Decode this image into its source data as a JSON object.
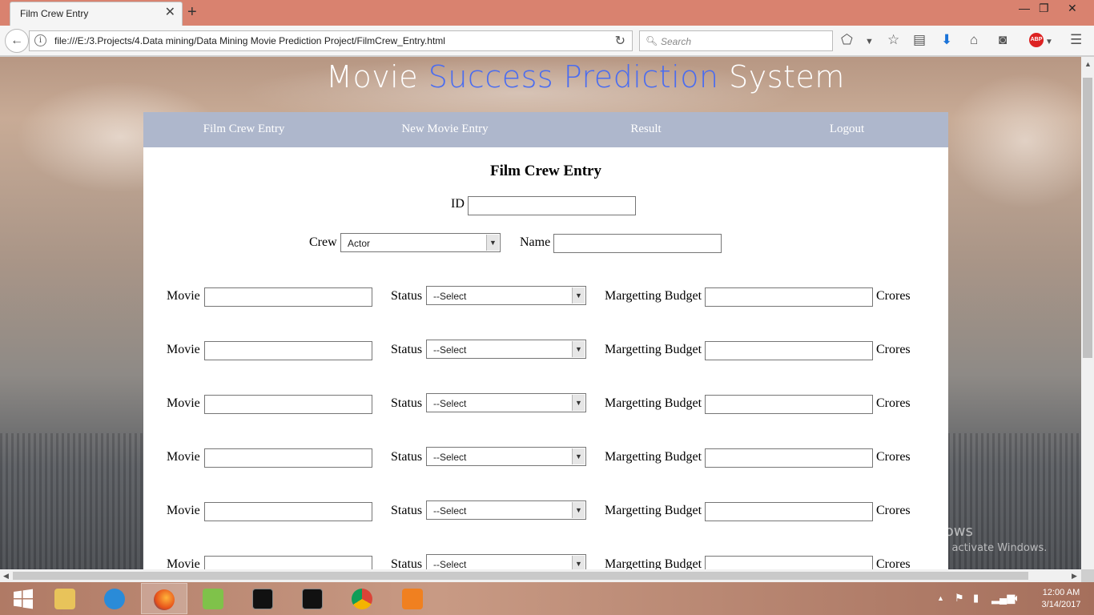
{
  "browser": {
    "tab_title": "Film Crew Entry",
    "url": "file:///E:/3.Projects/4.Data mining/Data Mining Movie Prediction Project/FilmCrew_Entry.html",
    "search_placeholder": "Search",
    "abp_label": "ABP"
  },
  "page": {
    "title_part1": "Movie",
    "title_part2": "Success Prediction",
    "title_part3": "System",
    "nav": [
      "Film Crew Entry",
      "New Movie Entry",
      "Result",
      "Logout"
    ],
    "form_title": "Film Crew Entry",
    "id_label": "ID",
    "crew_label": "Crew",
    "crew_selected": "Actor",
    "name_label": "Name",
    "movie_rows": [
      {
        "movie_label": "Movie",
        "status_label": "Status",
        "status_value": "--Select",
        "budget_label": "Margetting Budget",
        "unit": "Crores"
      },
      {
        "movie_label": "Movie",
        "status_label": "Status",
        "status_value": "--Select",
        "budget_label": "Margetting Budget",
        "unit": "Crores"
      },
      {
        "movie_label": "Movie",
        "status_label": "Status",
        "status_value": "--Select",
        "budget_label": "Margetting Budget",
        "unit": "Crores"
      },
      {
        "movie_label": "Movie",
        "status_label": "Status",
        "status_value": "--Select",
        "budget_label": "Margetting Budget",
        "unit": "Crores"
      },
      {
        "movie_label": "Movie",
        "status_label": "Status",
        "status_value": "--Select",
        "budget_label": "Margetting Budget",
        "unit": "Crores"
      },
      {
        "movie_label": "Movie",
        "status_label": "Status",
        "status_value": "--Select",
        "budget_label": "Margetting Budget",
        "unit": "Crores"
      }
    ]
  },
  "watermark": {
    "line1": "Activate Windows",
    "line2": "Go to PC settings to activate Windows."
  },
  "taskbar": {
    "time": "12:00 AM",
    "date": "3/14/2017"
  },
  "colors": {
    "accent": "#4a6cf0",
    "menu_bg": "#aeb7cc",
    "tabbar": "#d9826f"
  }
}
